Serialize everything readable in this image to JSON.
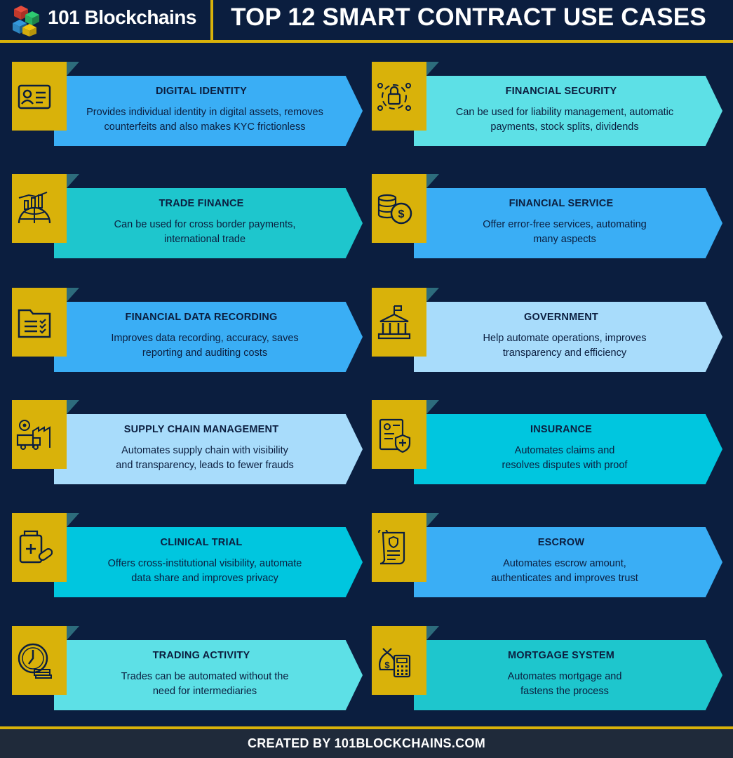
{
  "header": {
    "brand": "101 Blockchains",
    "title": "TOP 12 SMART CONTRACT USE CASES"
  },
  "colors": {
    "navy": "#0b1e3f",
    "gold": "#d9b20a",
    "blue": "#3aaef5",
    "cyan": "#5de0e6",
    "teal": "#1ec6cd",
    "light_blue": "#a8dcfb",
    "aqua": "#00c6df"
  },
  "cases": [
    {
      "title": "DIGITAL IDENTITY",
      "desc1": "Provides individual identity in digital assets, removes",
      "desc2": "counterfeits and also makes KYC frictionless",
      "icon": "id-card-icon",
      "color": "#3aaef5"
    },
    {
      "title": "FINANCIAL SECURITY",
      "desc1": "Can be used for liability management, automatic",
      "desc2": "payments, stock splits, dividends",
      "icon": "circuit-lock-icon",
      "color": "#5de0e6"
    },
    {
      "title": "TRADE FINANCE",
      "desc1": "Can be used for cross border payments,",
      "desc2": "international trade",
      "icon": "globe-chart-icon",
      "color": "#1ec6cd"
    },
    {
      "title": "FINANCIAL SERVICE",
      "desc1": "Offer error-free services, automating",
      "desc2": "many aspects",
      "icon": "coins-dollar-icon",
      "color": "#3aaef5"
    },
    {
      "title": "FINANCIAL DATA RECORDING",
      "desc1": "Improves data recording, accuracy, saves",
      "desc2": "reporting and auditing costs",
      "icon": "folder-checklist-icon",
      "color": "#3aaef5"
    },
    {
      "title": "GOVERNMENT",
      "desc1": "Help automate operations, improves",
      "desc2": "transparency and efficiency",
      "icon": "government-building-icon",
      "color": "#a8dcfb"
    },
    {
      "title": "SUPPLY CHAIN MANAGEMENT",
      "desc1": "Automates supply chain with visibility",
      "desc2": "and transparency, leads to fewer frauds",
      "icon": "factory-truck-icon",
      "color": "#a8dcfb"
    },
    {
      "title": "INSURANCE",
      "desc1": "Automates claims and",
      "desc2": "resolves disputes with proof",
      "icon": "insurance-document-icon",
      "color": "#00c6df"
    },
    {
      "title": "CLINICAL TRIAL",
      "desc1": "Offers cross-institutional visibility, automate",
      "desc2": "data share and improves privacy",
      "icon": "medicine-bottle-icon",
      "color": "#00c6df"
    },
    {
      "title": "ESCROW",
      "desc1": "Automates escrow amount,",
      "desc2": "authenticates and improves trust",
      "icon": "contract-scroll-icon",
      "color": "#3aaef5"
    },
    {
      "title": "TRADING ACTIVITY",
      "desc1": "Trades can be automated without the",
      "desc2": "need for intermediaries",
      "icon": "clock-coins-icon",
      "color": "#5de0e6"
    },
    {
      "title": "MORTGAGE SYSTEM",
      "desc1": "Automates mortgage and",
      "desc2": "fastens the process",
      "icon": "money-calculator-icon",
      "color": "#1ec6cd"
    }
  ],
  "footer": {
    "text": "CREATED BY 101BLOCKCHAINS.COM"
  }
}
